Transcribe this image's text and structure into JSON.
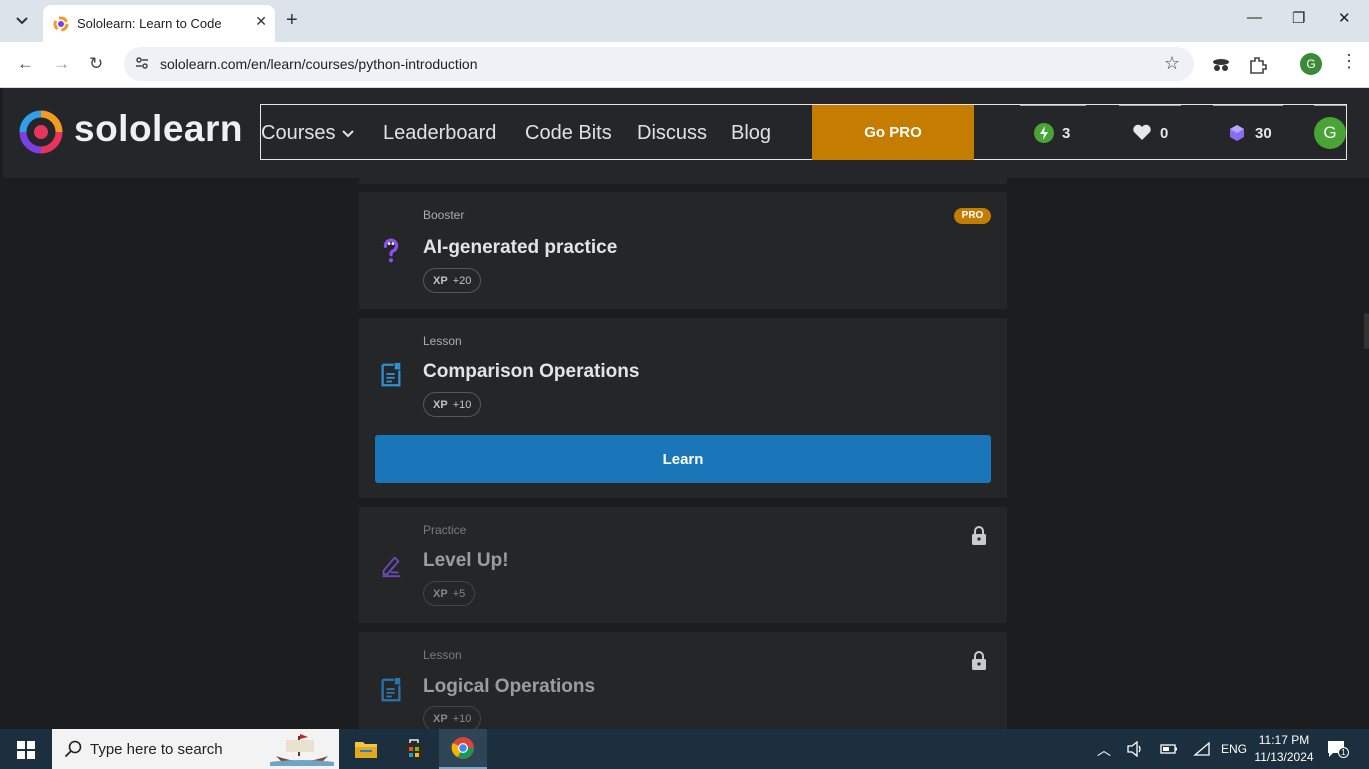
{
  "browser": {
    "tab_title": "Sololearn: Learn to Code",
    "new_tab": "+",
    "url": "sololearn.com/en/learn/courses/python-introduction",
    "window_controls": {
      "minimize": "—",
      "restore": "❐",
      "close": "✕"
    },
    "profile_initial": "G",
    "menu": "⋮"
  },
  "header": {
    "logo_text": "sololearn",
    "nav": {
      "courses": "Courses",
      "leaderboard": "Leaderboard",
      "code_bits": "Code Bits",
      "discuss": "Discuss",
      "blog": "Blog"
    },
    "go_pro": "Go PRO",
    "stats": {
      "streak": "3",
      "hearts": "0",
      "gems": "30"
    },
    "avatar_initial": "G",
    "colors": {
      "gopro": "#c57d00",
      "streak": "#4aa336",
      "gem": "#8a6cf0"
    }
  },
  "cards": [
    {
      "type": "Booster",
      "title": "AI-generated practice",
      "xp_label": "XP",
      "xp_value": "+20",
      "badge": "PRO",
      "icon": "question-icon",
      "locked": false
    },
    {
      "type": "Lesson",
      "title": "Comparison Operations",
      "xp_label": "XP",
      "xp_value": "+10",
      "button": "Learn",
      "icon": "lesson-doc-icon",
      "locked": false
    },
    {
      "type": "Practice",
      "title": "Level Up!",
      "xp_label": "XP",
      "xp_value": "+5",
      "icon": "practice-pencil-icon",
      "locked": true
    },
    {
      "type": "Lesson",
      "title": "Logical Operations",
      "xp_label": "XP",
      "xp_value": "+10",
      "icon": "lesson-doc-icon",
      "locked": true
    }
  ],
  "taskbar": {
    "search_placeholder": "Type here to search",
    "tray": {
      "lang": "ENG",
      "time": "11:17 PM",
      "date": "11/13/2024",
      "notifications": "1"
    }
  }
}
